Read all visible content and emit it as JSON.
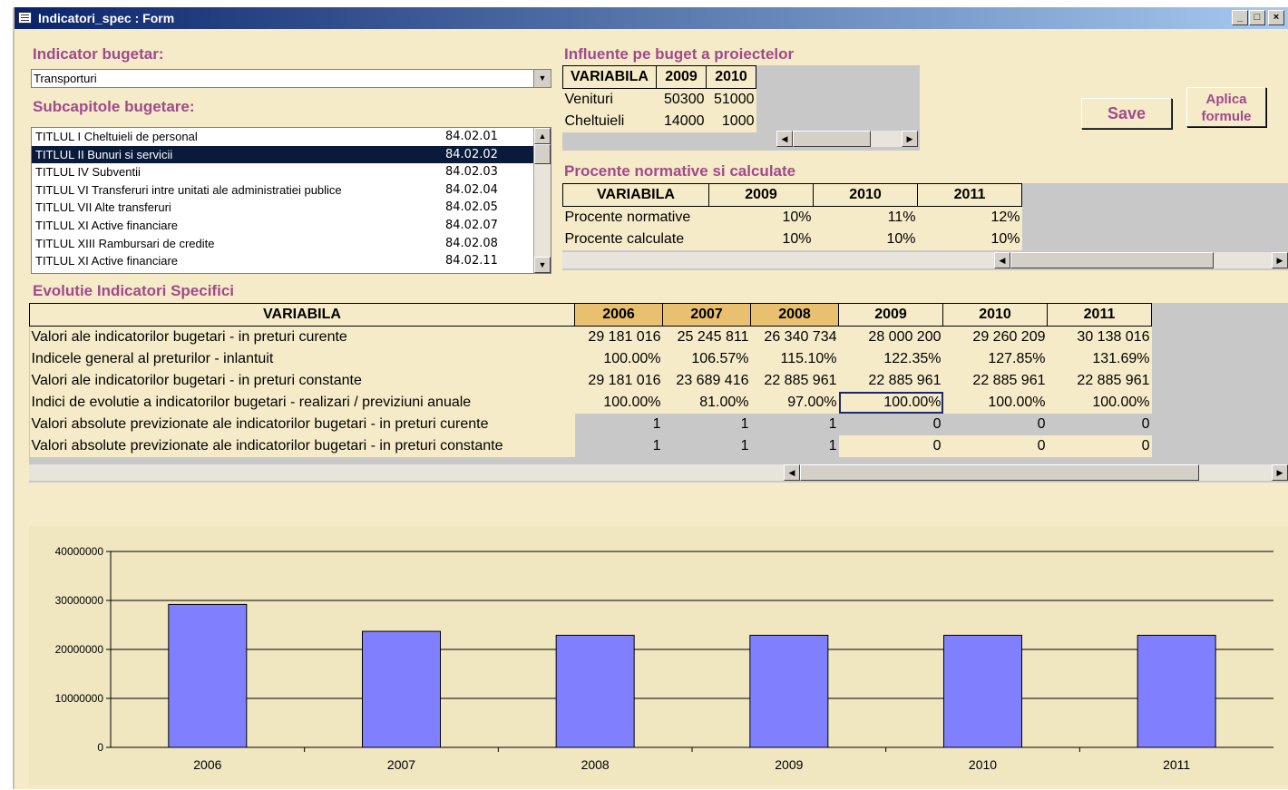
{
  "window": {
    "title": "Indicatori_spec : Form",
    "buttons": {
      "minimize": "_",
      "maximize": "□",
      "close": "×"
    }
  },
  "indicator": {
    "label": "Indicator bugetar:",
    "value": "Transporturi"
  },
  "subcapitole": {
    "label": "Subcapitole bugetare:",
    "items": [
      {
        "name": "TITLUL I Cheltuieli de personal",
        "code": "84.02.01",
        "selected": false
      },
      {
        "name": "TITLUL II Bunuri si servicii",
        "code": "84.02.02",
        "selected": true
      },
      {
        "name": "TITLUL IV Subventii",
        "code": "84.02.03",
        "selected": false
      },
      {
        "name": "TITLUL VI Transferuri intre unitati ale administratiei publice",
        "code": "84.02.04",
        "selected": false
      },
      {
        "name": "TITLUL VII Alte transferuri",
        "code": "84.02.05",
        "selected": false
      },
      {
        "name": "TITLUL XI Active financiare",
        "code": "84.02.07",
        "selected": false
      },
      {
        "name": "TITLUL XIII Rambursari de credite",
        "code": "84.02.08",
        "selected": false
      },
      {
        "name": "TITLUL XI Active financiare",
        "code": "84.02.11",
        "selected": false
      }
    ]
  },
  "influente": {
    "label": "Influente pe buget a proiectelor",
    "headers": [
      "VARIABILA",
      "2009",
      "2010"
    ],
    "rows": [
      [
        "Venituri",
        "50300",
        "51000"
      ],
      [
        "Cheltuieli",
        "14000",
        "1000"
      ]
    ]
  },
  "procente": {
    "label": "Procente normative si calculate",
    "headers": [
      "VARIABILA",
      "2009",
      "2010",
      "2011"
    ],
    "rows": [
      [
        "Procente normative",
        "10%",
        "11%",
        "12%"
      ],
      [
        "Procente calculate",
        "10%",
        "10%",
        "10%"
      ]
    ]
  },
  "buttons": {
    "save": "Save",
    "aplica_line1": "Aplica",
    "aplica_line2": "formule"
  },
  "evolutie": {
    "label": "Evolutie Indicatori Specifici",
    "headers": [
      "VARIABILA",
      "2006",
      "2007",
      "2008",
      "2009",
      "2010",
      "2011"
    ],
    "rows": [
      [
        "Valori ale indicatorilor bugetari - in preturi curente",
        "29 181 016",
        "25 245 811",
        "26 340 734",
        "28 000 200",
        "29 260 209",
        "30 138 016"
      ],
      [
        "Indicele general al preturilor - inlantuit",
        "100.00%",
        "106.57%",
        "115.10%",
        "122.35%",
        "127.85%",
        "131.69%"
      ],
      [
        "Valori ale indicatorilor bugetari - in preturi constante",
        "29 181 016",
        "23 689 416",
        "22 885 961",
        "22 885 961",
        "22 885 961",
        "22 885 961"
      ],
      [
        "Indici de evolutie a indicatorilor bugetari - realizari / previziuni anuale",
        "100.00%",
        "81.00%",
        "97.00%",
        "100.00%",
        "100.00%",
        "100.00%"
      ],
      [
        "Valori absolute previzionate ale indicatorilor bugetari - in preturi curente",
        "1",
        "1",
        "1",
        "0",
        "0",
        "0"
      ],
      [
        "Valori absolute previzionate ale indicatorilor bugetari - in preturi constante",
        "1",
        "1",
        "1",
        "0",
        "0",
        "0"
      ]
    ]
  },
  "chart_data": {
    "type": "bar",
    "categories": [
      "2006",
      "2007",
      "2008",
      "2009",
      "2010",
      "2011"
    ],
    "values": [
      29181016,
      23689416,
      22885961,
      22885961,
      22885961,
      22885961
    ],
    "yticks": [
      "0",
      "10000000",
      "20000000",
      "30000000",
      "40000000"
    ],
    "ylim": [
      0,
      40000000
    ],
    "bar_color": "#8080ff",
    "grid": true,
    "title": "",
    "xlabel": "",
    "ylabel": ""
  }
}
